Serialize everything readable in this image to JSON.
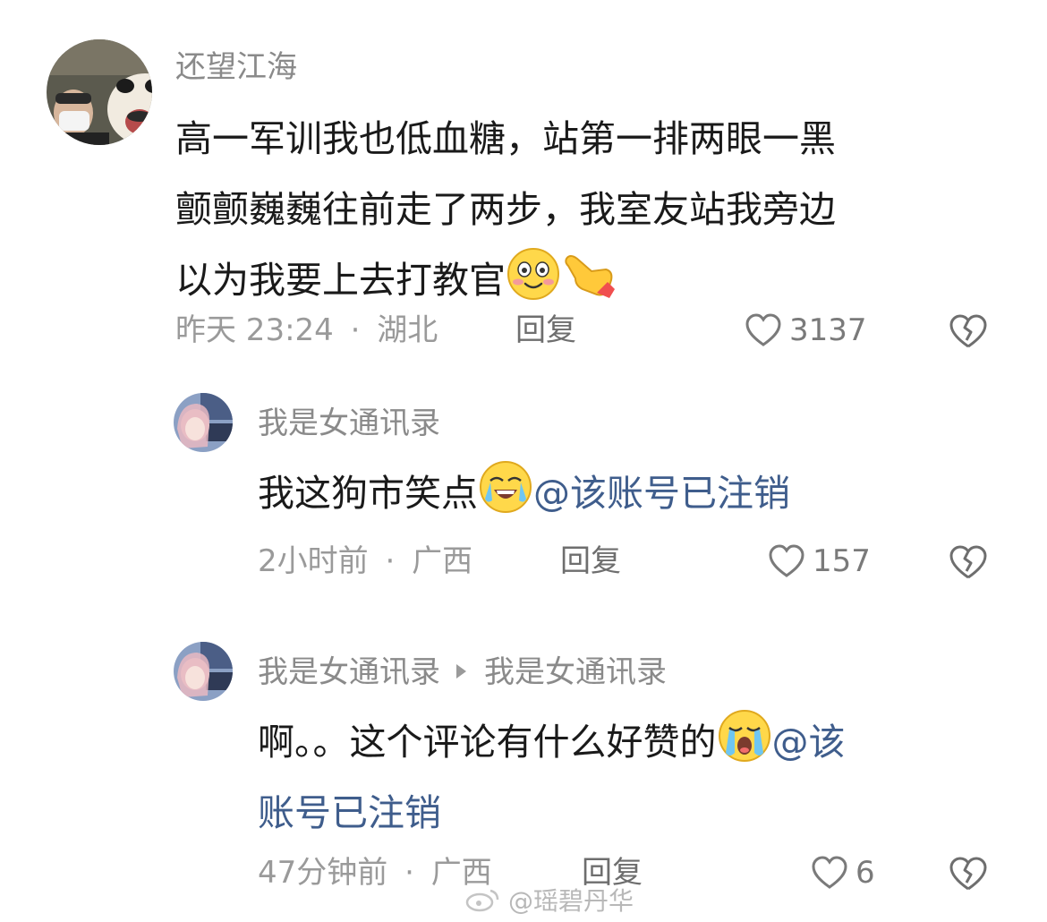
{
  "comments": [
    {
      "username": "还望江海",
      "text_lines": [
        "高一军训我也低血糖，站第一排两眼一黑",
        "颤颤巍巍往前走了两步，我室友站我旁边",
        "以为我要上去打教官"
      ],
      "emojis": [
        "blushing-face-emoji",
        "pointing-hand-emoji"
      ],
      "time": "昨天 23:24",
      "location": "湖北",
      "reply_label": "回复",
      "likes": "3137"
    },
    {
      "username": "我是女通讯录",
      "text": "我这狗市笑点",
      "emoji": "crying-laughing-emoji",
      "mention": "@该账号已注销",
      "time": "2小时前",
      "location": "广西",
      "reply_label": "回复",
      "likes": "157"
    },
    {
      "username": "我是女通讯录",
      "reply_to": "我是女通讯录",
      "text": "啊。。这个评论有什么好赞的",
      "emoji": "crying-face-emoji",
      "mention_part1": "@该",
      "mention_part2": "账号已注销",
      "time": "47分钟前",
      "location": "广西",
      "reply_label": "回复",
      "likes": "6"
    }
  ],
  "separator": "·",
  "watermark": "@瑶碧丹华",
  "colors": {
    "username": "#8a8a8a",
    "mention": "#3f5d8c",
    "meta": "#9a9a9a"
  }
}
